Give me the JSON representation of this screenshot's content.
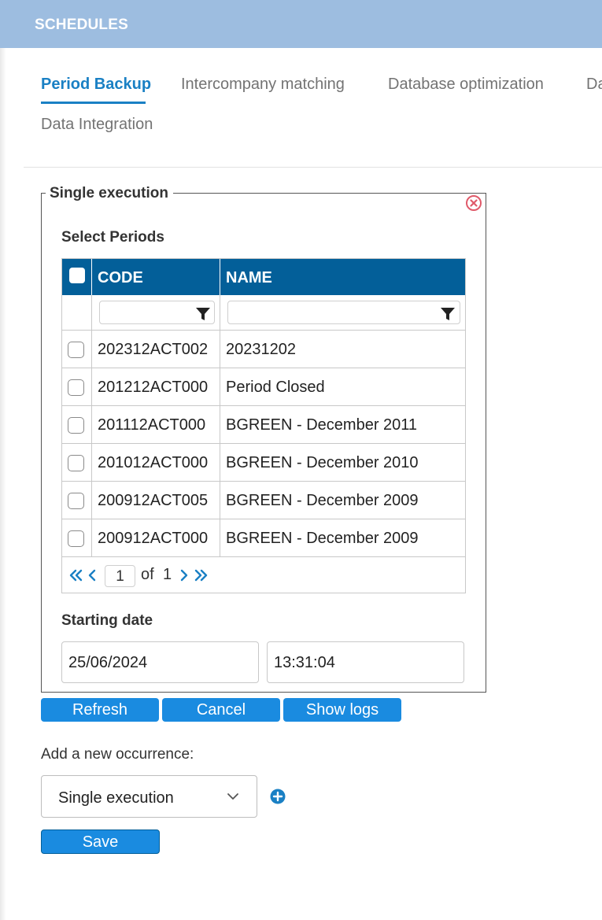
{
  "header": {
    "title": "SCHEDULES"
  },
  "tabs": [
    {
      "label": "Period Backup",
      "active": true
    },
    {
      "label": "Intercompany matching",
      "active": false
    },
    {
      "label": "Database optimization",
      "active": false
    },
    {
      "label": "Da",
      "active": false
    },
    {
      "label": "Data Integration",
      "active": false
    }
  ],
  "panel": {
    "legend": "Single execution",
    "select_periods_label": "Select Periods",
    "grid": {
      "columns": [
        "CODE",
        "NAME"
      ],
      "rows": [
        {
          "code": "202312ACT002",
          "name": "20231202"
        },
        {
          "code": "201212ACT000",
          "name": "Period Closed"
        },
        {
          "code": "201112ACT000",
          "name": "BGREEN - December 2011"
        },
        {
          "code": "201012ACT000",
          "name": "BGREEN - December 2010"
        },
        {
          "code": "200912ACT005",
          "name": "BGREEN - December 2009"
        },
        {
          "code": "200912ACT000",
          "name": "BGREEN - December 2009"
        }
      ],
      "pager": {
        "page": "1",
        "of_label": "of",
        "total": "1"
      }
    },
    "starting_date_label": "Starting date",
    "date_value": "25/06/2024",
    "time_value": "13:31:04"
  },
  "buttons": {
    "refresh": "Refresh",
    "cancel": "Cancel",
    "show_logs": "Show logs",
    "save": "Save"
  },
  "occurrence": {
    "label": "Add a new occurrence:",
    "selected": "Single execution"
  },
  "colors": {
    "header_bg": "#9dbde0",
    "accent": "#1a80c4",
    "grid_header": "#035f99",
    "button": "#1a8be0",
    "close_icon": "#e05a6a"
  }
}
